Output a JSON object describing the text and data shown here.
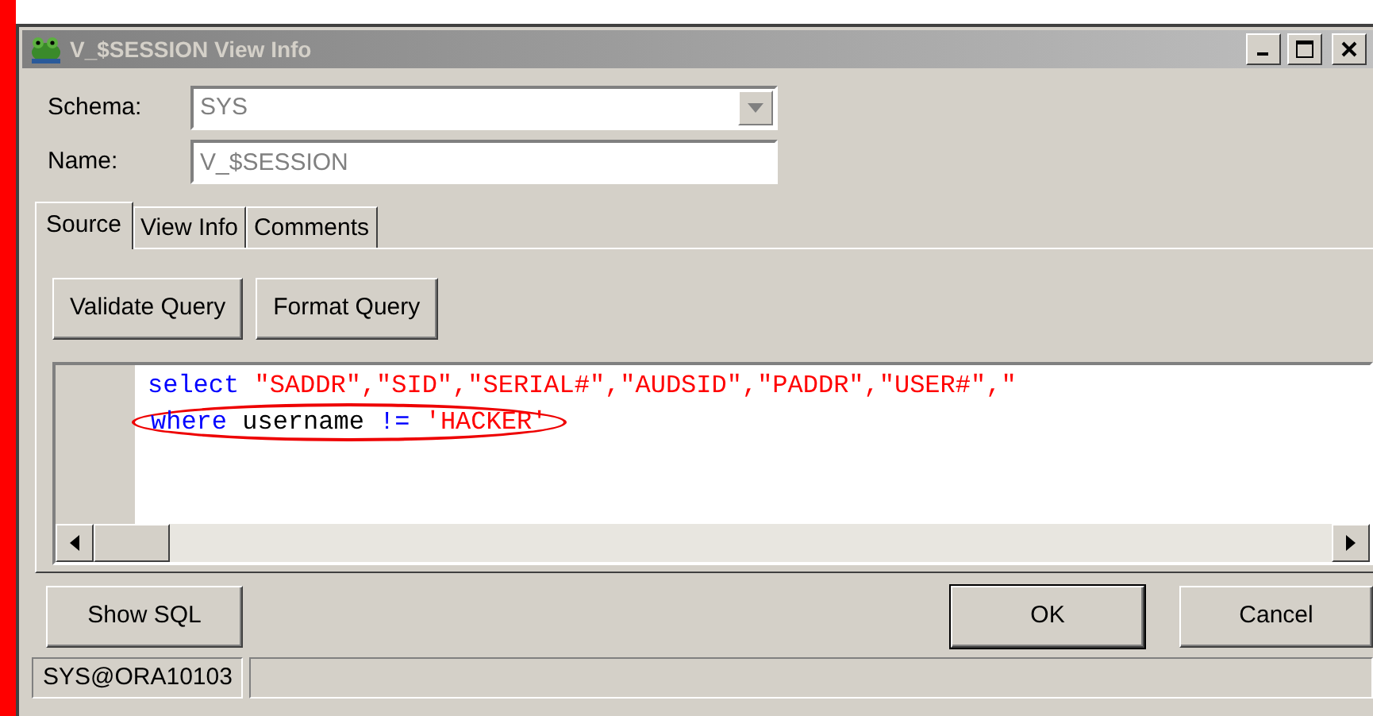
{
  "window": {
    "title": "V_$SESSION View Info"
  },
  "schema": {
    "label": "Schema:",
    "value": "SYS",
    "disabled": true
  },
  "name": {
    "label": "Name:",
    "value": "V_$SESSION",
    "disabled": true
  },
  "tabs": [
    {
      "label": "Source",
      "selected": true
    },
    {
      "label": "View Info",
      "selected": false
    },
    {
      "label": "Comments",
      "selected": false
    }
  ],
  "query_buttons": [
    "Validate Query",
    "Format Query"
  ],
  "editor": {
    "lines": [
      {
        "circled": false,
        "tokens": [
          {
            "kind": "keyword",
            "text": "select"
          },
          {
            "kind": "string",
            "text": " \"SADDR\",\"SID\",\"SERIAL#\",\"AUDSID\",\"PADDR\",\"USER#\",\""
          }
        ]
      },
      {
        "circled": true,
        "tokens": [
          {
            "kind": "keyword",
            "text": "where"
          },
          {
            "kind": "plain",
            "text": " username "
          },
          {
            "kind": "keyword",
            "text": "!="
          },
          {
            "kind": "string",
            "text": " 'HACKER'"
          }
        ]
      }
    ]
  },
  "footer_buttons": [
    {
      "label": "Show SQL",
      "default": false
    },
    {
      "label": "OK",
      "default": true
    },
    {
      "label": "Cancel",
      "default": false
    }
  ],
  "status_bar": [
    "SYS@ORA10103"
  ]
}
